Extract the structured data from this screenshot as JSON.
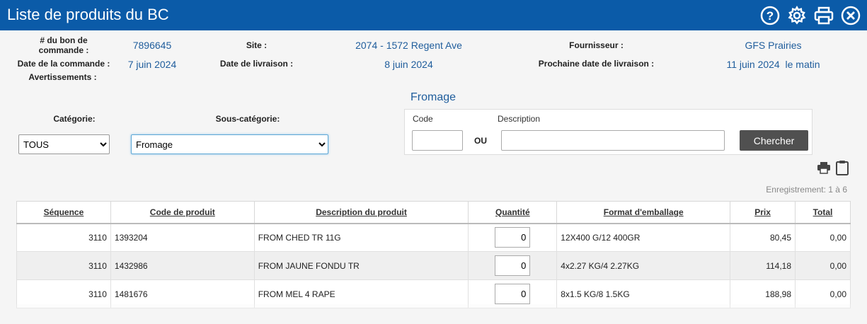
{
  "header": {
    "title": "Liste de produits du BC"
  },
  "info": {
    "po_label": "# du bon de commande :",
    "po_value": "7896645",
    "site_label": "Site :",
    "site_value": "2074 - 1572 Regent Ave",
    "supplier_label": "Fournisseur :",
    "supplier_value": "GFS Prairies",
    "order_date_label": "Date de la commande :",
    "order_date_value": "7 juin 2024",
    "delivery_date_label": "Date de livraison :",
    "delivery_date_value": "8 juin 2024",
    "next_delivery_label": "Prochaine date de livraison :",
    "next_delivery_value": "11 juin 2024  le matin",
    "warnings_label": "Avertissements :"
  },
  "filters": {
    "section_title": "Fromage",
    "category_label": "Catégorie:",
    "category_value": "TOUS",
    "subcategory_label": "Sous-catégorie:",
    "subcategory_value": "Fromage",
    "code_label": "Code",
    "description_label": "Description",
    "or_label": "OU",
    "search_button": "Chercher"
  },
  "record_count": "Enregistrement: 1 à 6",
  "table": {
    "headers": {
      "sequence": "Séquence",
      "code": "Code de produit",
      "description": "Description du produit",
      "quantity": "Quantité",
      "format": "Format d'emballage",
      "price": "Prix",
      "total": "Total"
    },
    "rows": [
      {
        "sequence": "3110",
        "code": "1393204",
        "description": "FROM CHED TR 11G",
        "quantity": "0",
        "format": "12X400 G/12 400GR",
        "price": "80,45",
        "total": "0,00"
      },
      {
        "sequence": "3110",
        "code": "1432986",
        "description": "FROM JAUNE FONDU TR",
        "quantity": "0",
        "format": "4x2.27 KG/4 2.27KG",
        "price": "114,18",
        "total": "0,00"
      },
      {
        "sequence": "3110",
        "code": "1481676",
        "description": "FROM MEL 4 RAPE",
        "quantity": "0",
        "format": "8x1.5 KG/8 1.5KG",
        "price": "188,98",
        "total": "0,00"
      }
    ]
  },
  "icons": {
    "help": "help-icon",
    "settings": "gear-icon",
    "print": "printer-icon",
    "close": "close-icon",
    "clipboard": "clipboard-icon"
  }
}
